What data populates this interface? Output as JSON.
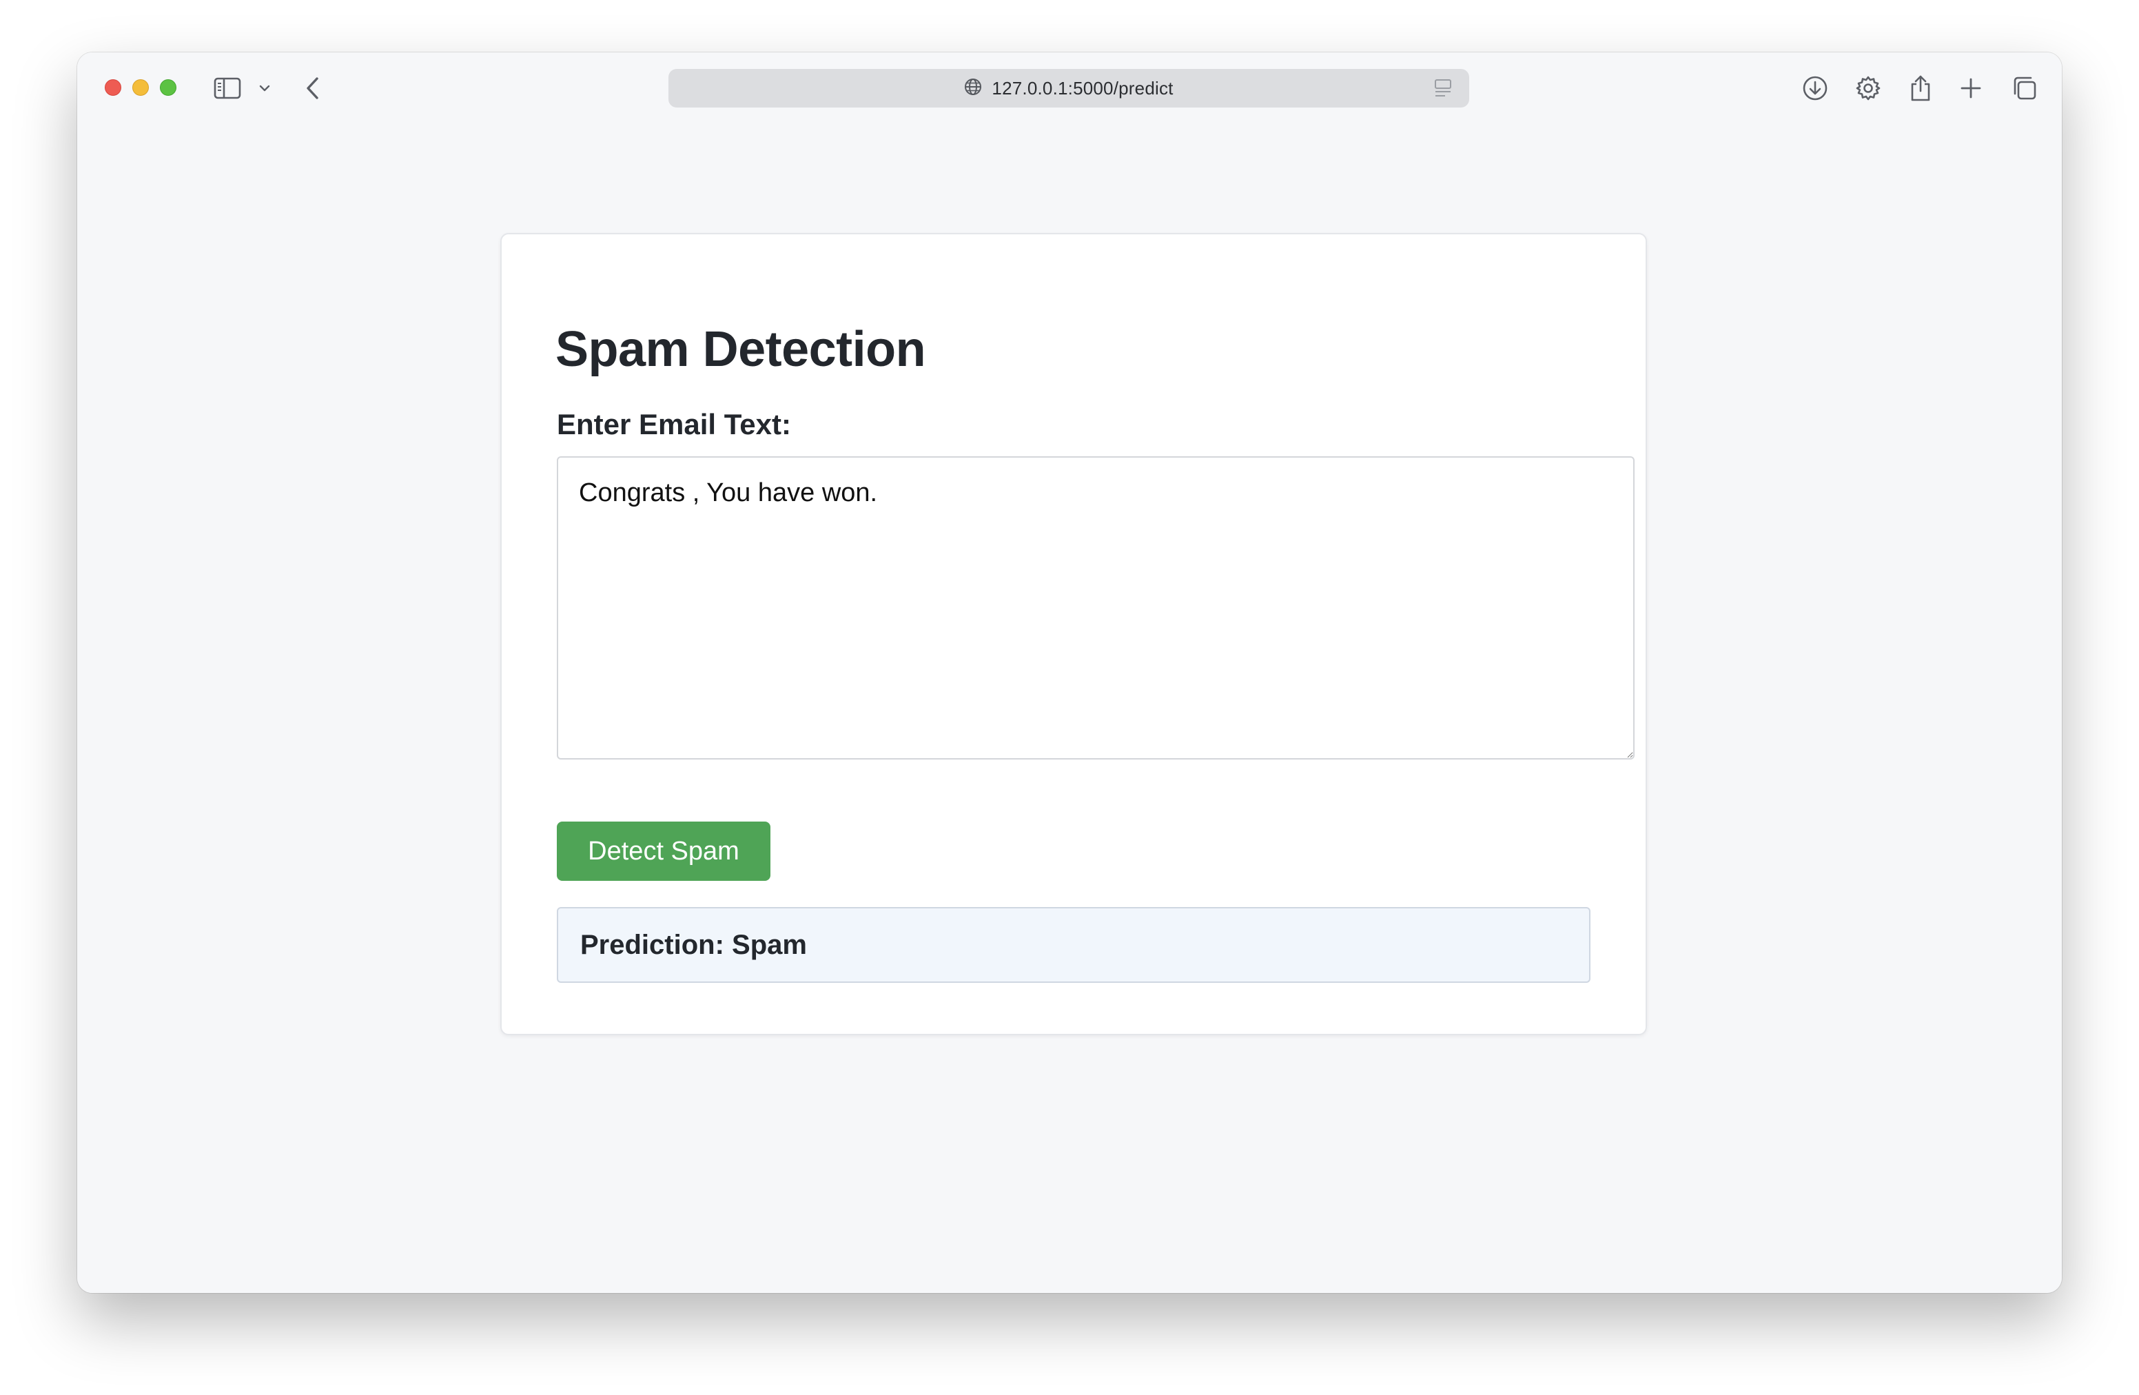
{
  "browser": {
    "url": "127.0.0.1:5000/predict",
    "icons": {
      "sidebar": "sidebar-icon",
      "chevron": "chevron-down-icon",
      "back": "back-arrow-icon",
      "globe": "globe-icon",
      "reader": "reader-icon",
      "download": "download-icon",
      "settings": "gear-icon",
      "share": "share-icon",
      "new_tab": "plus-icon",
      "tabs": "tabs-overview-icon"
    },
    "traffic_colors": {
      "close": "#ee5c53",
      "minimize": "#f4bd3a",
      "zoom": "#5cc243"
    }
  },
  "page": {
    "title": "Spam Detection",
    "label": "Enter Email Text:",
    "textarea_value": "Congrats , You have won.",
    "button_label": "Detect Spam",
    "prediction": "Prediction: Spam",
    "colors": {
      "button": "#4fa456",
      "prediction_bg": "#f1f6fc"
    }
  }
}
